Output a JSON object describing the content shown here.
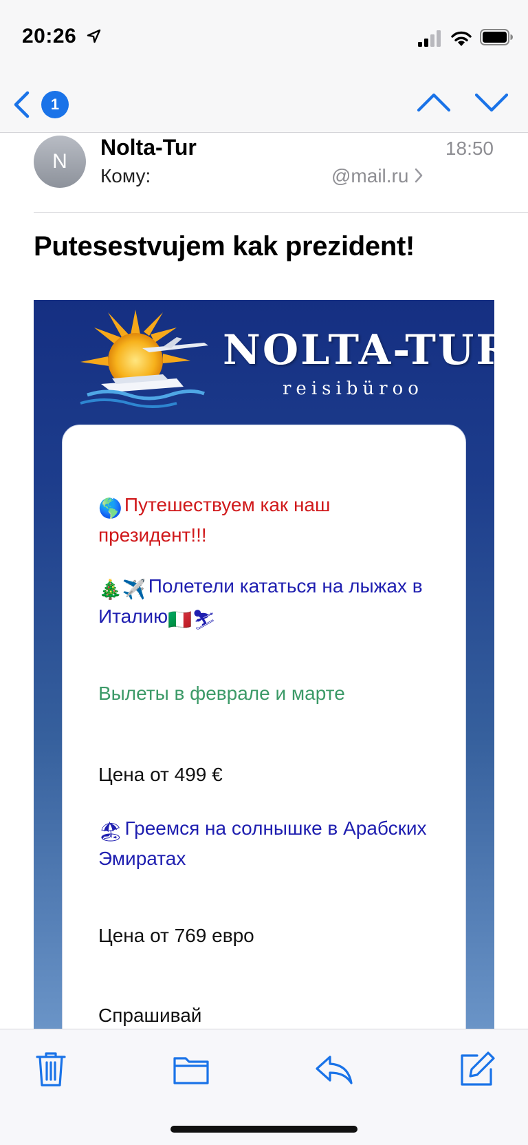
{
  "status_bar": {
    "time": "20:26"
  },
  "nav": {
    "unread_count": "1"
  },
  "message": {
    "avatar_initial": "N",
    "sender": "Nolta-Tur",
    "time": "18:50",
    "to_label": "Кому:",
    "recipient": "@mail.ru",
    "subject": "Putesestvujem kak prezident!"
  },
  "newsletter": {
    "brand_name": "NOLTA-TUR",
    "brand_tagline": "reisibüroo",
    "blocks": [
      {
        "emoji": "🌎",
        "text": "Путешествуем как наш президент!!!"
      },
      {
        "emoji": "🎄✈️",
        "text": "Полетели кататься  на лыжах  в Италию",
        "trail_emoji": "🇮🇹⛷"
      },
      {
        "text": "Вылеты в феврале и марте"
      },
      {
        "text": "Цена от 499 €"
      },
      {
        "emoji": "🏖",
        "text": "Греемся на солнышке в Арабских Эмиратах"
      },
      {
        "text": "Цена от 769 евро"
      },
      {
        "text": "Спрашивай"
      }
    ]
  },
  "colors": {
    "accent_blue": "#1a73e8",
    "newsletter_bg_top": "#152f82",
    "newsletter_bg_bottom": "#6a94c7",
    "text_red": "#d0191b",
    "text_blue": "#1f1fb0",
    "text_green": "#3c9a68",
    "text_gray": "#8e8e93"
  },
  "icons": {
    "back": "chevron-left-icon",
    "prev": "chevron-up-icon",
    "next": "chevron-down-icon",
    "trash": "trash-icon",
    "folder": "folder-icon",
    "reply": "reply-icon",
    "compose": "compose-icon"
  }
}
